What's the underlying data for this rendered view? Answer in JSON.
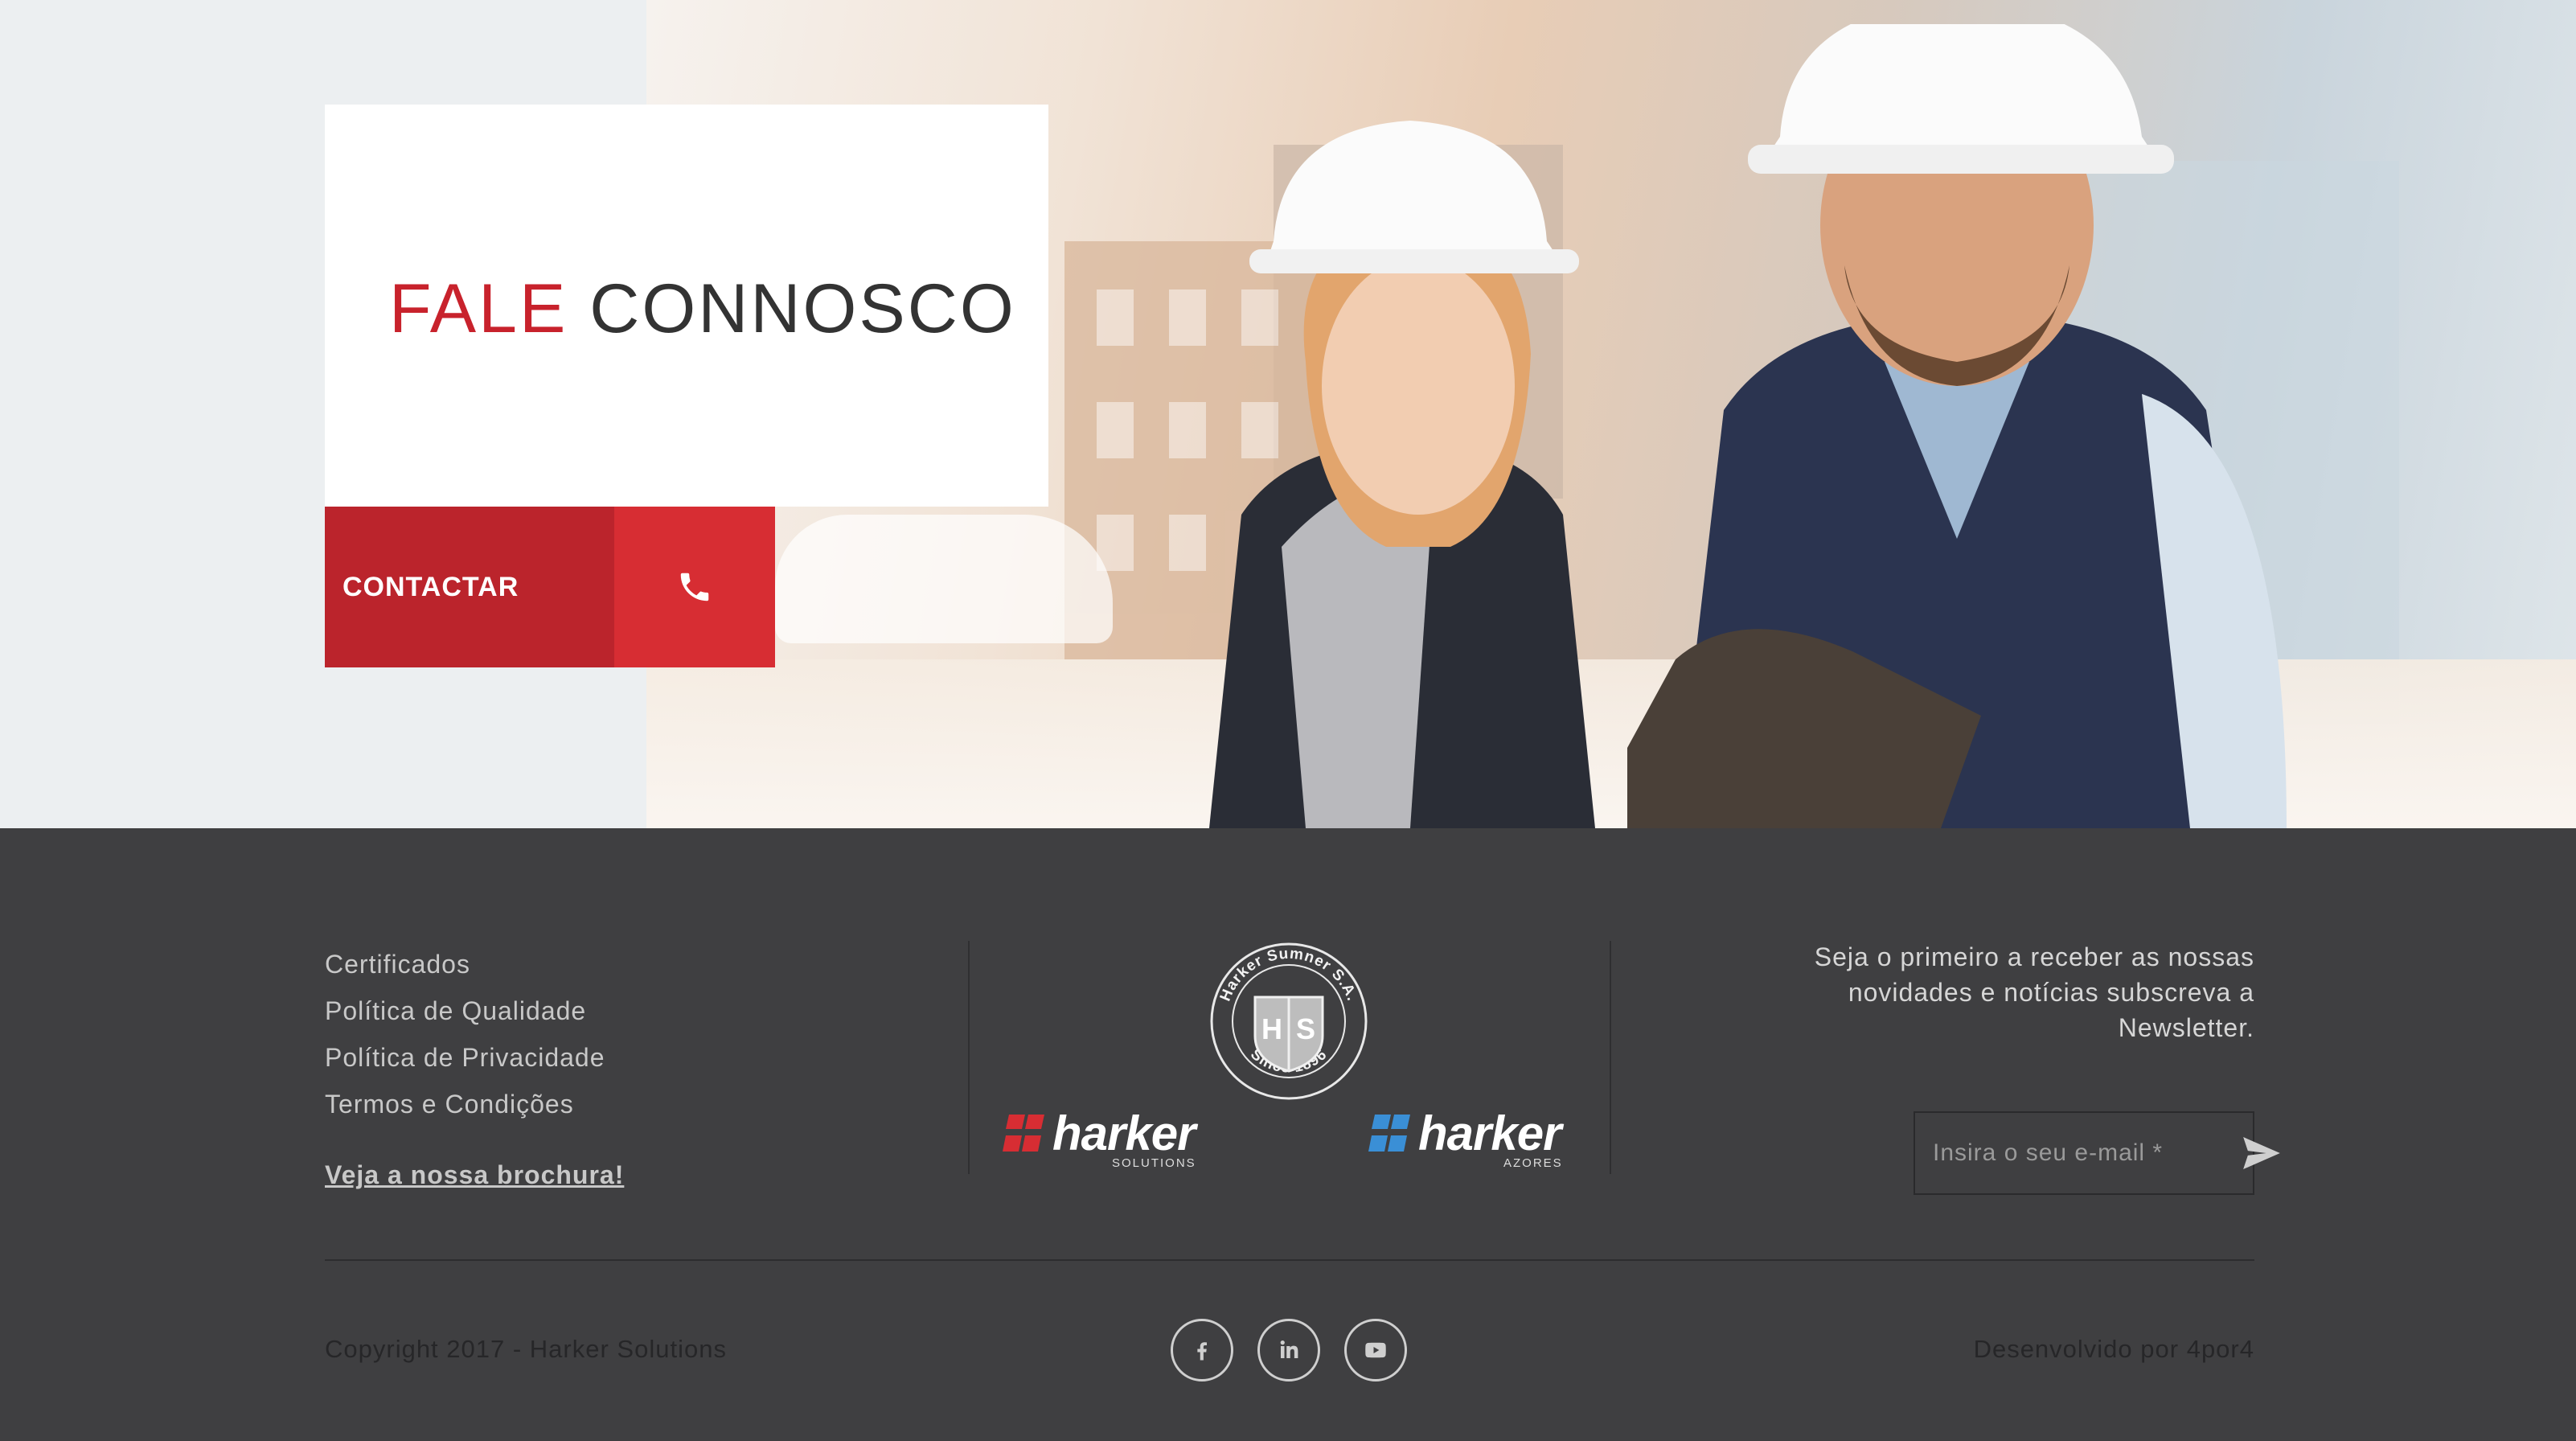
{
  "hero": {
    "title_accent": "FALE",
    "title_rest": "CONNOSCO",
    "cta_label": "CONTACTAR",
    "cta_icon": "phone-icon"
  },
  "footer": {
    "links": [
      "Certificados",
      "Política de Qualidade",
      "Política de Privacidade",
      "Termos e Condições"
    ],
    "brochure": "Veja a nossa brochura!",
    "seal": {
      "top_text": "Harker Sumner S.A.",
      "bottom_text": "Since 1896",
      "initials_left": "H",
      "initials_right": "S"
    },
    "logos": [
      {
        "name": "harker",
        "sub": "SOLUTIONS",
        "color": "#d72d33"
      },
      {
        "name": "harker",
        "sub": "AZORES",
        "color": "#3a8fd6"
      }
    ],
    "newsletter_text": "Seja o primeiro a receber as nossas novidades e notícias subscreva a Newsletter.",
    "email_placeholder": "Insira o seu e-mail *",
    "copyright": "Copyright 2017 - Harker Solutions",
    "developer": "Desenvolvido por 4por4",
    "social": [
      "facebook-icon",
      "linkedin-icon",
      "youtube-icon"
    ]
  },
  "colors": {
    "accent": "#c8222c",
    "cta_dark": "#bb242c",
    "cta_light": "#d72d33",
    "footer_bg": "#3f3f41"
  }
}
